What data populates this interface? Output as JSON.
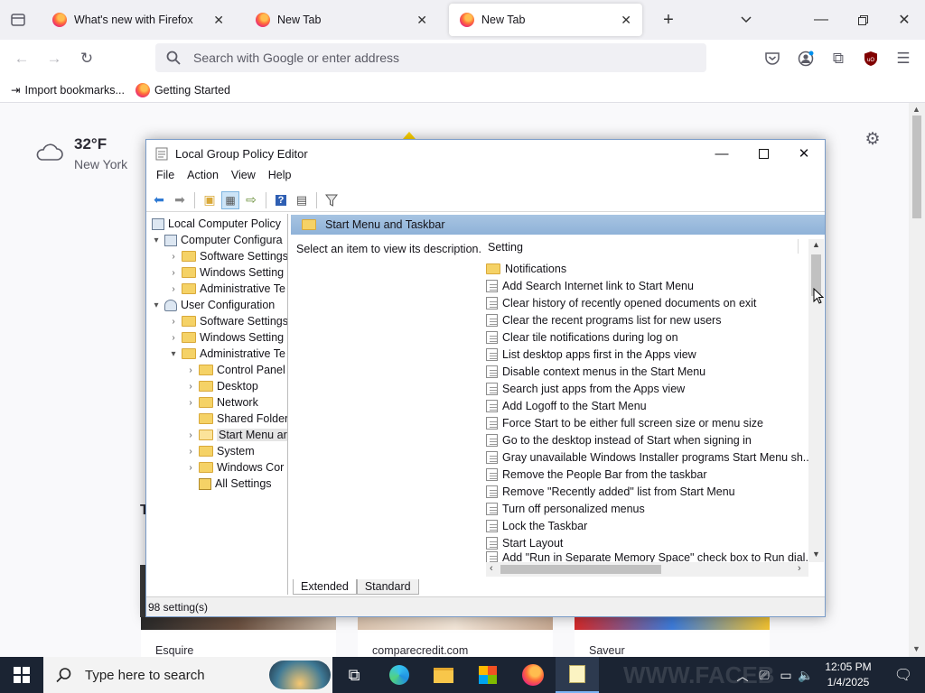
{
  "browser": {
    "tabs": [
      {
        "title": "What's new with Firefox"
      },
      {
        "title": "New Tab"
      },
      {
        "title": "New Tab"
      }
    ],
    "url_placeholder": "Search with Google or enter address",
    "bookmarks": [
      {
        "label": "Import bookmarks..."
      },
      {
        "label": "Getting Started"
      }
    ]
  },
  "newtab": {
    "weather": {
      "temp": "32°F",
      "location": "New York"
    },
    "stories": [
      {
        "source": "Esquire"
      },
      {
        "source": "comparecredit.com"
      },
      {
        "source": "Saveur"
      }
    ],
    "partial_heading": "T"
  },
  "gpedit": {
    "title": "Local Group Policy Editor",
    "menu": [
      "File",
      "Action",
      "View",
      "Help"
    ],
    "tree": [
      {
        "label": "Local Computer Policy"
      },
      {
        "label": "Computer Configura"
      },
      {
        "label": "Software Settings"
      },
      {
        "label": "Windows Setting"
      },
      {
        "label": "Administrative Te"
      },
      {
        "label": "User Configuration"
      },
      {
        "label": "Software Settings"
      },
      {
        "label": "Windows Setting"
      },
      {
        "label": "Administrative Te"
      },
      {
        "label": "Control Panel"
      },
      {
        "label": "Desktop"
      },
      {
        "label": "Network"
      },
      {
        "label": "Shared Folder"
      },
      {
        "label": "Start Menu ar"
      },
      {
        "label": "System"
      },
      {
        "label": "Windows Cor"
      },
      {
        "label": "All Settings"
      }
    ],
    "section_title": "Start Menu and Taskbar",
    "description": "Select an item to view its description.",
    "column_header": "Setting",
    "settings": [
      "Notifications",
      "Add Search Internet link to Start Menu",
      "Clear history of recently opened documents on exit",
      "Clear the recent programs list for new users",
      "Clear tile notifications during log on",
      "List desktop apps first in the Apps view",
      "Disable context menus in the Start Menu",
      "Search just apps from the Apps view",
      "Add Logoff to the Start Menu",
      "Force Start to be either full screen size or menu size",
      "Go to the desktop instead of Start when signing in",
      "Gray unavailable Windows Installer programs Start Menu sh...",
      "Remove the People Bar from the taskbar",
      "Remove \"Recently added\" list from Start Menu",
      "Turn off personalized menus",
      "Lock the Taskbar",
      "Start Layout",
      "Add \"Run in Separate Memory Space\" check box to Run dial..."
    ],
    "view_tabs": [
      "Extended",
      "Standard"
    ],
    "status": "98 setting(s)"
  },
  "taskbar": {
    "search_placeholder": "Type here to search",
    "time": "12:05 PM",
    "date": "1/4/2025"
  }
}
